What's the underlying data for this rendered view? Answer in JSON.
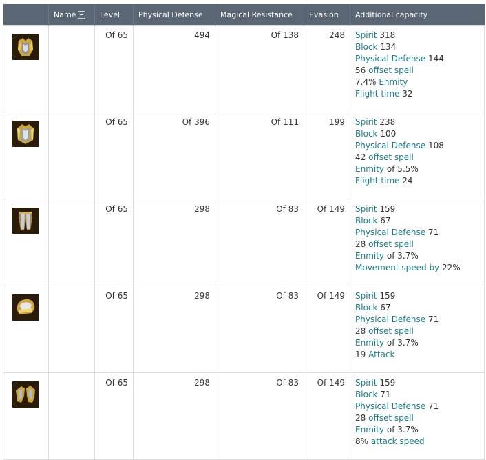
{
  "columns": {
    "name": "Name",
    "level": "Level",
    "physical_defense": "Physical Defense",
    "magical_resistance": "Magical Resistance",
    "evasion": "Evasion",
    "additional": "Additional capacity"
  },
  "rows": [
    {
      "icon": "armor-chest-icon",
      "level": "Of 65",
      "physical_defense": "494",
      "magical_resistance": "Of 138",
      "evasion": "248",
      "caps": [
        {
          "k": "Spirit",
          "v": "318"
        },
        {
          "k": "Block",
          "v": "134"
        },
        {
          "k": "Physical Defense",
          "v": "144"
        },
        {
          "pre": "56",
          "k": "offset spell"
        },
        {
          "pre": "7.4%",
          "k": "Enmity"
        },
        {
          "k": "Flight time",
          "v": "32"
        }
      ]
    },
    {
      "icon": "armor-pauldron-icon",
      "level": "Of 65",
      "physical_defense": "Of 396",
      "magical_resistance": "Of 111",
      "evasion": "199",
      "caps": [
        {
          "k": "Spirit",
          "v": "238"
        },
        {
          "k": "Block",
          "v": "100"
        },
        {
          "k": "Physical Defense",
          "v": "108"
        },
        {
          "pre": "42",
          "k": "offset spell"
        },
        {
          "k": "Enmity",
          "v": "of 5.5%"
        },
        {
          "k": "Flight time",
          "v": "24"
        }
      ]
    },
    {
      "icon": "armor-legs-icon",
      "level": "Of 65",
      "physical_defense": "298",
      "magical_resistance": "Of 83",
      "evasion": "Of 149",
      "caps": [
        {
          "k": "Spirit",
          "v": "159"
        },
        {
          "k": "Block",
          "v": "67"
        },
        {
          "k": "Physical Defense",
          "v": "71"
        },
        {
          "pre": "28",
          "k": "offset spell"
        },
        {
          "k": "Enmity",
          "v": "of 3.7%"
        },
        {
          "k": "Movement speed by",
          "v": "22%"
        }
      ]
    },
    {
      "icon": "armor-helmet-icon",
      "level": "Of 65",
      "physical_defense": "298",
      "magical_resistance": "Of 83",
      "evasion": "Of 149",
      "caps": [
        {
          "k": "Spirit",
          "v": "159"
        },
        {
          "k": "Block",
          "v": "67"
        },
        {
          "k": "Physical Defense",
          "v": "71"
        },
        {
          "pre": "28",
          "k": "offset spell"
        },
        {
          "k": "Enmity",
          "v": "of 3.7%"
        },
        {
          "pre": "19",
          "k": "Attack"
        }
      ]
    },
    {
      "icon": "armor-gloves-icon",
      "level": "Of 65",
      "physical_defense": "298",
      "magical_resistance": "Of 83",
      "evasion": "Of 149",
      "caps": [
        {
          "k": "Spirit",
          "v": "159"
        },
        {
          "k": "Block",
          "v": "71"
        },
        {
          "k": "Physical Defense",
          "v": "71"
        },
        {
          "pre": "28",
          "k": "offset spell"
        },
        {
          "k": "Enmity",
          "v": "of 3.7%"
        },
        {
          "pre": "8%",
          "k": "attack speed"
        }
      ]
    }
  ],
  "colors": {
    "header_bg": "#5b6674",
    "stat_name": "#1f7b8a",
    "border": "#dcdcdc"
  }
}
